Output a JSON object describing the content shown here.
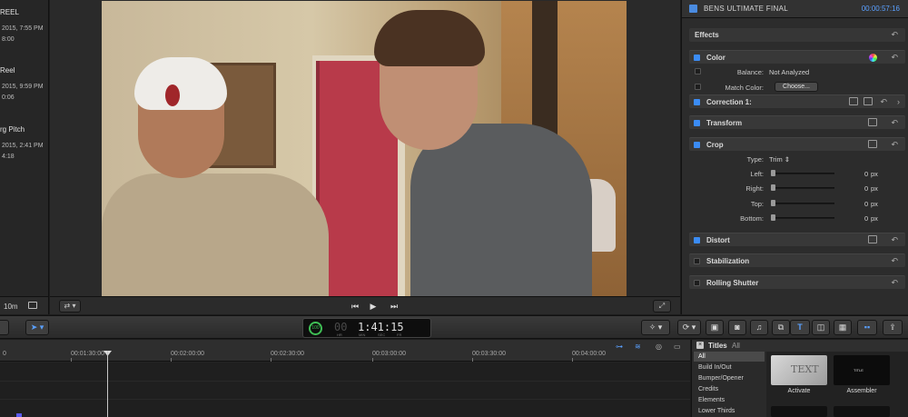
{
  "browser": {
    "clips": [
      {
        "name": "REEL",
        "date": "2015, 7:55 PM",
        "duration": "8:00"
      },
      {
        "name": "Reel",
        "date": "2015, 9:59 PM",
        "duration": "0:06"
      },
      {
        "name": "rg Pitch",
        "date": "2015, 2:41 PM",
        "duration": "4:18"
      }
    ],
    "zoom_label": "10m"
  },
  "viewer": {
    "transport": {
      "prev": "⏮",
      "play": "▶",
      "next": "⏭"
    },
    "options_glyph": "⇄ ▾",
    "fullscreen_glyph": "⤢"
  },
  "inspector": {
    "title": "BENS ULTIMATE FINAL",
    "timecode": "00:00:57:16",
    "effects_label": "Effects",
    "sections": {
      "color": "Color",
      "correction": "Correction 1:",
      "transform": "Transform",
      "crop": "Crop",
      "distort": "Distort",
      "stabilization": "Stabilization",
      "rolling_shutter": "Rolling Shutter"
    },
    "color_rows": {
      "balance_label": "Balance:",
      "balance_value": "Not Analyzed",
      "match_label": "Match Color:",
      "choose_button": "Choose..."
    },
    "crop_rows": {
      "type_label": "Type:",
      "type_value": "Trim  ⇕",
      "left_label": "Left:",
      "right_label": "Right:",
      "top_label": "Top:",
      "bottom_label": "Bottom:",
      "left_value": "0",
      "right_value": "0",
      "top_value": "0",
      "bottom_value": "0",
      "unit": "px"
    },
    "reset_glyph": "↶"
  },
  "toolbar": {
    "timecode_dim": "00",
    "timecode_value": "1:41:15",
    "timecode_badge": "100",
    "timecode_units": [
      "HR",
      "MIN",
      "SEC",
      "FR"
    ],
    "select_tool": "➤ ▾",
    "magic_tool": "✧ ▾",
    "retime_tool": "⟳ ▾",
    "share_glyph": "⇪"
  },
  "timeline": {
    "ticks": [
      "0",
      "00:01:30:00",
      "00:02:00:00",
      "00:02:30:00",
      "00:03:00:00",
      "00:03:30:00",
      "00:04:00:00"
    ]
  },
  "titles": {
    "label": "Titles",
    "all_label": "All",
    "categories": [
      "All",
      "Build In/Out",
      "Bumper/Opener",
      "Credits",
      "Elements",
      "Lower Thirds"
    ],
    "thumbnails": [
      {
        "label": "Activate",
        "art_text": "TEXT"
      },
      {
        "label": "Assembler",
        "art_text": "TITLE"
      }
    ]
  },
  "colors": {
    "accent_blue": "#3b8cf5",
    "timecode_blue": "#5aa0ff",
    "timecode_green": "#3fbf55"
  }
}
